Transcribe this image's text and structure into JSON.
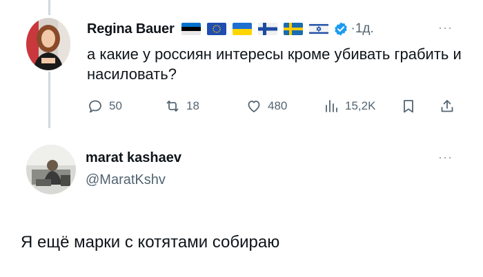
{
  "tweet1": {
    "author": "Regina Bauer",
    "flags": [
      "flag-estonia-icon",
      "flag-eu-icon",
      "flag-ukraine-icon",
      "flag-finland-icon",
      "flag-sweden-icon",
      "flag-israel-icon"
    ],
    "verified_icon": "verified-badge-icon",
    "time": "·1д.",
    "more": "···",
    "text": "а какие у россиян интересы кроме убивать грабить и насиловать?",
    "stats": {
      "replies": "50",
      "retweets": "18",
      "likes": "480",
      "views": "15,2K"
    }
  },
  "tweet2": {
    "author": "marat kashaev",
    "handle": "@MaratKshv",
    "more": "···",
    "text": "Я ещё марки с котятами собираю"
  },
  "colors": {
    "text": "#0f1419",
    "secondary": "#536471",
    "verified": "#1d9bf0",
    "thread_line": "#cfd9de"
  }
}
